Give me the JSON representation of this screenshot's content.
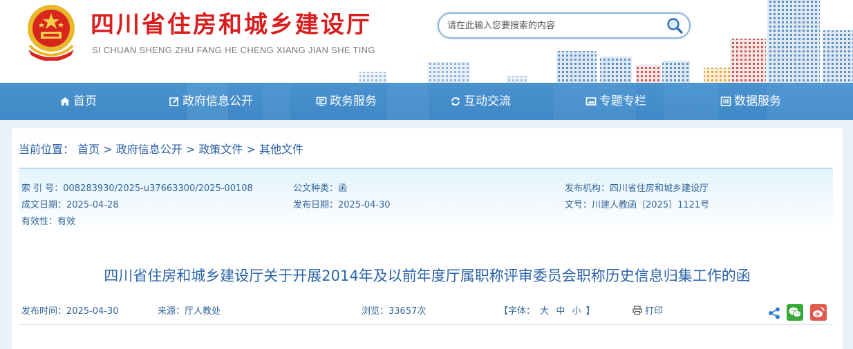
{
  "header": {
    "site_name": "四川省住房和城乡建设厅",
    "site_pinyin": "SI CHUAN SHENG ZHU FANG HE CHENG XIANG JIAN SHE TING",
    "search": {
      "placeholder": "请在此输入您要搜索的内容",
      "value": ""
    }
  },
  "nav": {
    "items": [
      {
        "label": "首页",
        "icon": "home-icon"
      },
      {
        "label": "政府信息公开",
        "icon": "edit-icon"
      },
      {
        "label": "政务服务",
        "icon": "monitor-icon"
      },
      {
        "label": "互动交流",
        "icon": "exchange-icon"
      },
      {
        "label": "专题专栏",
        "icon": "image-icon"
      },
      {
        "label": "数据服务",
        "icon": "data-icon"
      }
    ]
  },
  "breadcrumb": {
    "prefix": "当前位置：",
    "items": [
      "首页",
      "政府信息公开",
      "政策文件",
      "其他文件"
    ],
    "separator": ">"
  },
  "info": {
    "index_no": "索 引 号：008283930/2025-u37663300/2025-00108",
    "doc_type": "公文种类：函",
    "publisher": "发布机构：四川省住房和城乡建设厅",
    "created_date": "成文日期：2025-04-28",
    "publish_date": "发布日期：2025-04-30",
    "doc_no": "文号：川建人教函〔2025〕1121号",
    "validity": "有效性：有效"
  },
  "article": {
    "title": "四川省住房和城乡建设厅关于开展2014年及以前年度厅属职称评审委员会职称历史信息归集工作的函",
    "publish_time": "发布时间：2025-04-30",
    "source": "来源：厅人教处",
    "views": "浏览：33657次",
    "font_label": "【字体：",
    "font_large": "大",
    "font_medium": "中",
    "font_small": "小",
    "font_close": "】",
    "print_label": "打印"
  },
  "colors": {
    "brand_red": "#d81e1e",
    "nav_blue": "#3f87c6",
    "link_blue": "#2a5fa5",
    "wechat_green": "#37a936",
    "weibo_red": "#e05a4d"
  }
}
